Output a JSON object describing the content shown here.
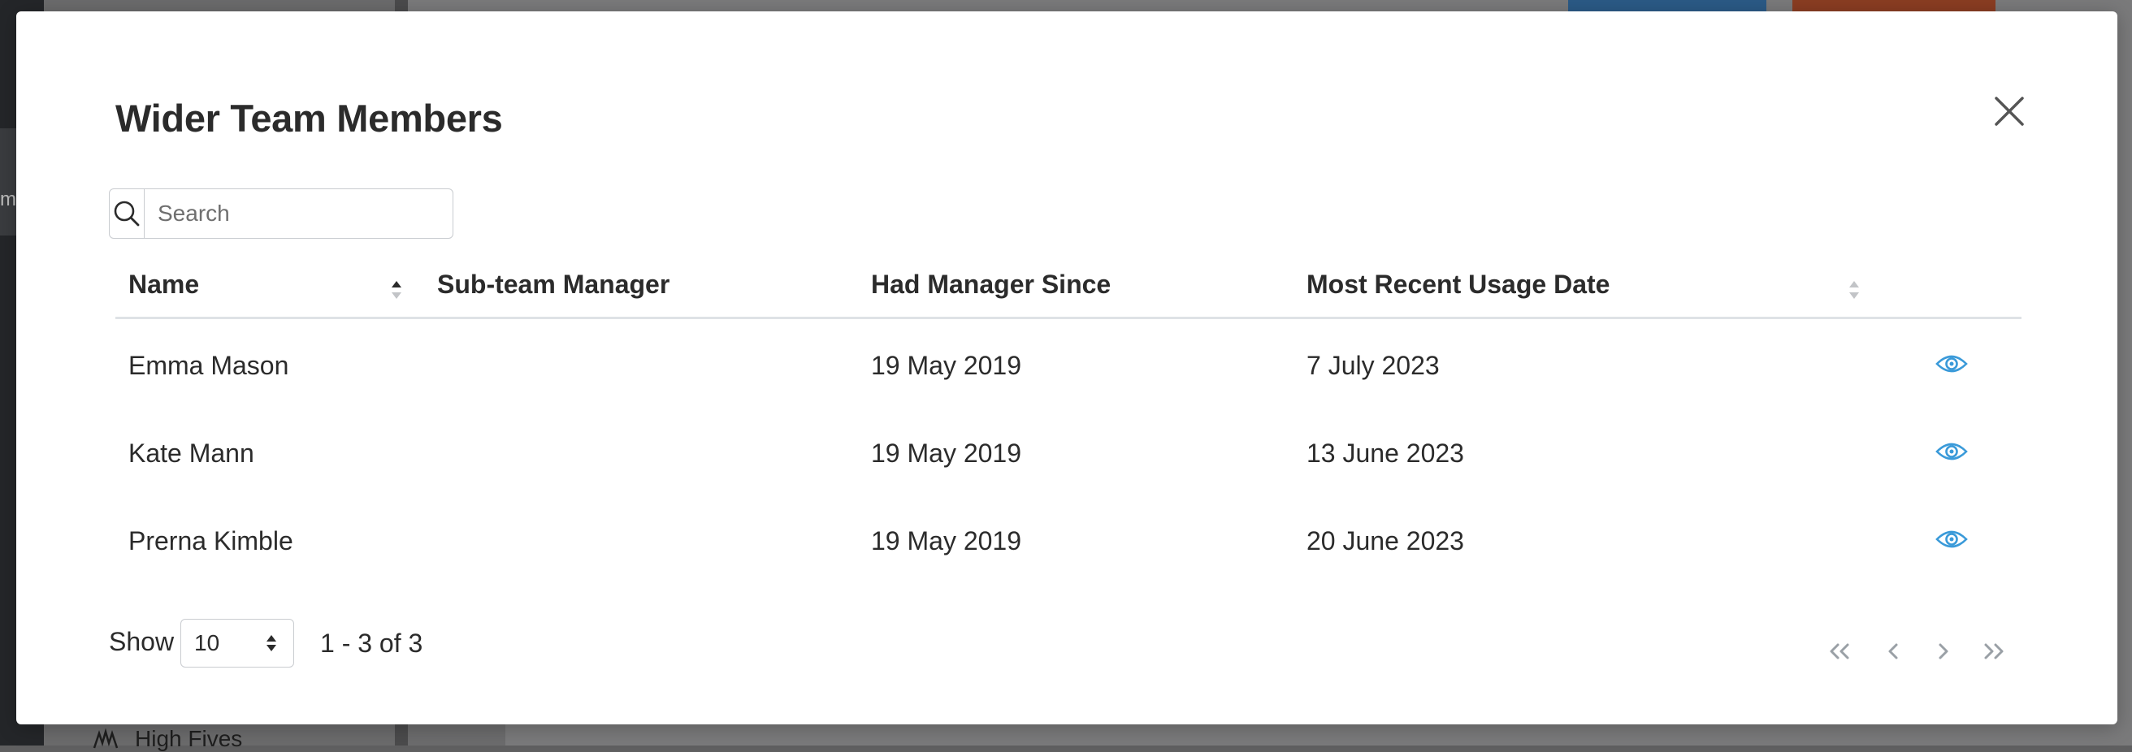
{
  "background": {
    "nav_fragment": "m",
    "high_fives_label": "High Fives"
  },
  "modal": {
    "title": "Wider Team Members",
    "close_icon": "close-icon"
  },
  "search": {
    "placeholder": "Search",
    "value": "",
    "icon": "search-icon"
  },
  "table": {
    "columns": [
      {
        "label": "Name",
        "sortable": true
      },
      {
        "label": "Sub-team Manager",
        "sortable": false
      },
      {
        "label": "Had Manager Since",
        "sortable": false
      },
      {
        "label": "Most Recent Usage Date",
        "sortable": true
      }
    ],
    "rows": [
      {
        "name": "Emma Mason",
        "sub_team_manager": "",
        "had_manager_since": "19 May 2019",
        "most_recent_usage": "7 July 2023",
        "action_icon": "eye-icon"
      },
      {
        "name": "Kate Mann",
        "sub_team_manager": "",
        "had_manager_since": "19 May 2019",
        "most_recent_usage": "13 June 2023",
        "action_icon": "eye-icon"
      },
      {
        "name": "Prerna Kimble",
        "sub_team_manager": "",
        "had_manager_since": "19 May 2019",
        "most_recent_usage": "20 June 2023",
        "action_icon": "eye-icon"
      }
    ]
  },
  "footer": {
    "show_label": "Show",
    "page_size": "10",
    "range_text": "1 - 3 of 3"
  },
  "colors": {
    "accent": "#3a9ad9",
    "text": "#2b2b2b",
    "border": "#c9ccd0"
  }
}
